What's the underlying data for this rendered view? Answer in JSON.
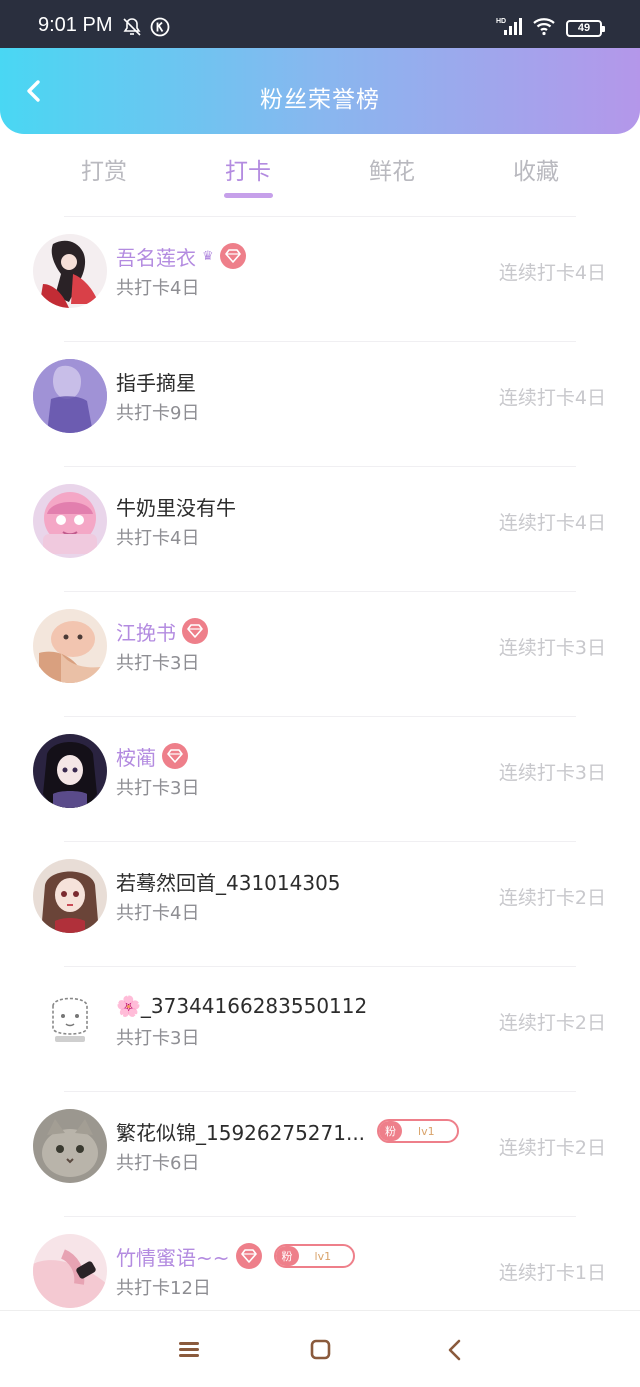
{
  "status_bar": {
    "time": "9:01 PM",
    "icons": [
      "bell-off-icon",
      "k-app-icon"
    ],
    "network": "HD",
    "battery": "49"
  },
  "header": {
    "title": "粉丝荣誉榜",
    "back_icon": "chevron-left-icon",
    "gradient": [
      "#49d7f3",
      "#88b7ef",
      "#b497ea"
    ]
  },
  "tabs": [
    {
      "label": "打赏",
      "active": false
    },
    {
      "label": "打卡",
      "active": true
    },
    {
      "label": "鲜花",
      "active": false
    },
    {
      "label": "收藏",
      "active": false
    }
  ],
  "fans": [
    {
      "name": "吾名莲衣",
      "crown": "♛",
      "vip": true,
      "diamond": true,
      "fan_badge": null,
      "total": "共打卡4日",
      "streak": "连续打卡4日"
    },
    {
      "name": "指手摘星",
      "crown": "",
      "vip": false,
      "diamond": false,
      "fan_badge": null,
      "total": "共打卡9日",
      "streak": "连续打卡4日"
    },
    {
      "name": "牛奶里没有牛",
      "crown": "",
      "vip": false,
      "diamond": false,
      "fan_badge": null,
      "total": "共打卡4日",
      "streak": "连续打卡4日"
    },
    {
      "name": "江挽书",
      "crown": "",
      "vip": true,
      "diamond": true,
      "fan_badge": null,
      "total": "共打卡3日",
      "streak": "连续打卡3日"
    },
    {
      "name": "桉蔺",
      "crown": "",
      "vip": true,
      "diamond": true,
      "fan_badge": null,
      "total": "共打卡3日",
      "streak": "连续打卡3日"
    },
    {
      "name": "若蓦然回首_431014305",
      "crown": "",
      "vip": false,
      "diamond": false,
      "fan_badge": null,
      "total": "共打卡4日",
      "streak": "连续打卡2日"
    },
    {
      "name": "🌸_37344166283550112",
      "crown": "",
      "vip": false,
      "diamond": false,
      "fan_badge": null,
      "total": "共打卡3日",
      "streak": "连续打卡2日"
    },
    {
      "name": "繁花似锦_15926275271...",
      "crown": "",
      "vip": false,
      "diamond": false,
      "fan_badge": {
        "label": "粉",
        "level": "lv1"
      },
      "total": "共打卡6日",
      "streak": "连续打卡2日"
    },
    {
      "name": "竹情蜜语~~",
      "crown": "",
      "vip": true,
      "diamond": true,
      "fan_badge": {
        "label": "粉",
        "level": "lv1"
      },
      "total": "共打卡12日",
      "streak": "连续打卡1日"
    }
  ],
  "colors": {
    "accent": "#b38be0",
    "badge": "#ee7f8a",
    "muted": "#c8c8cc"
  },
  "nav_bar": {
    "icons": [
      "menu-icon",
      "home-square-icon",
      "back-triangle-icon"
    ]
  }
}
